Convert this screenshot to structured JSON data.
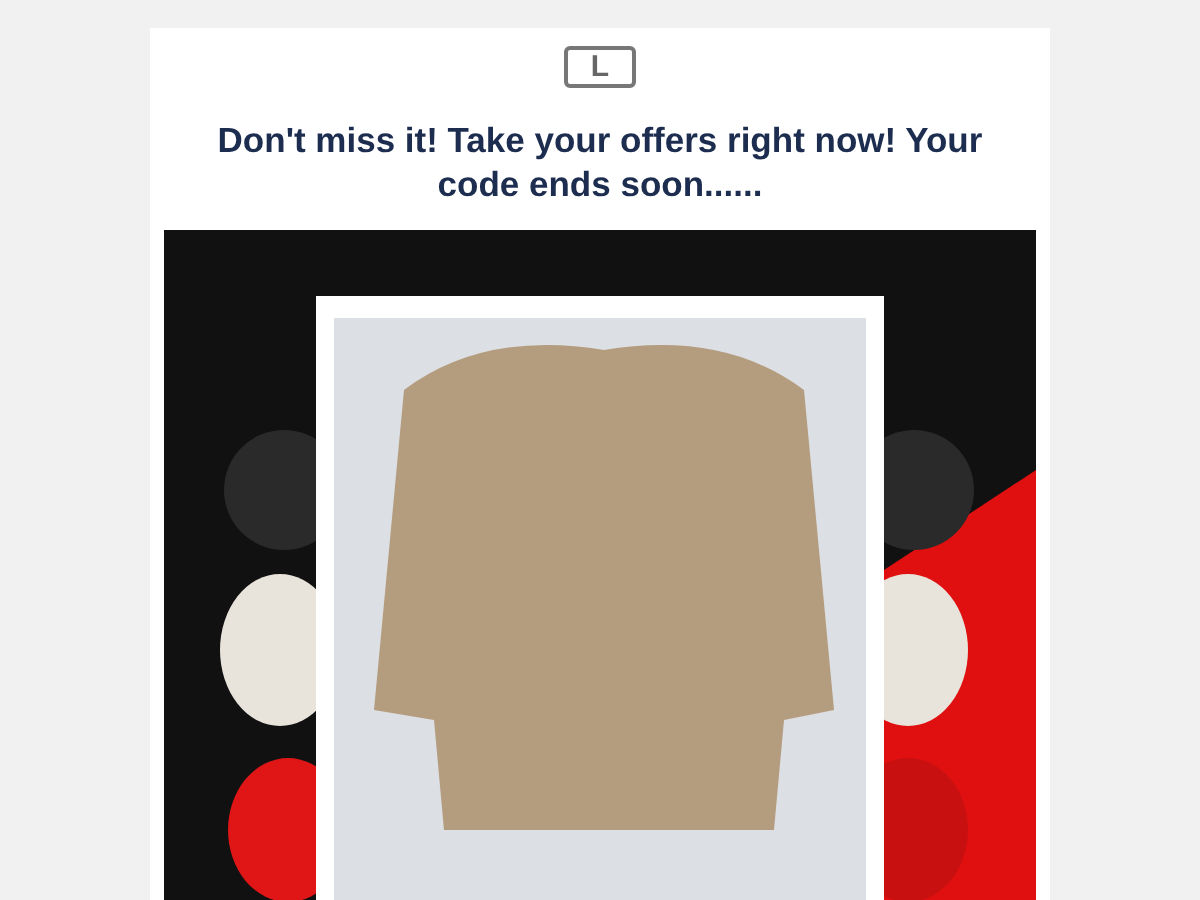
{
  "header": {
    "logo": "L"
  },
  "headline": "Don't miss it! Take your offers right now! Your code ends soon......"
}
